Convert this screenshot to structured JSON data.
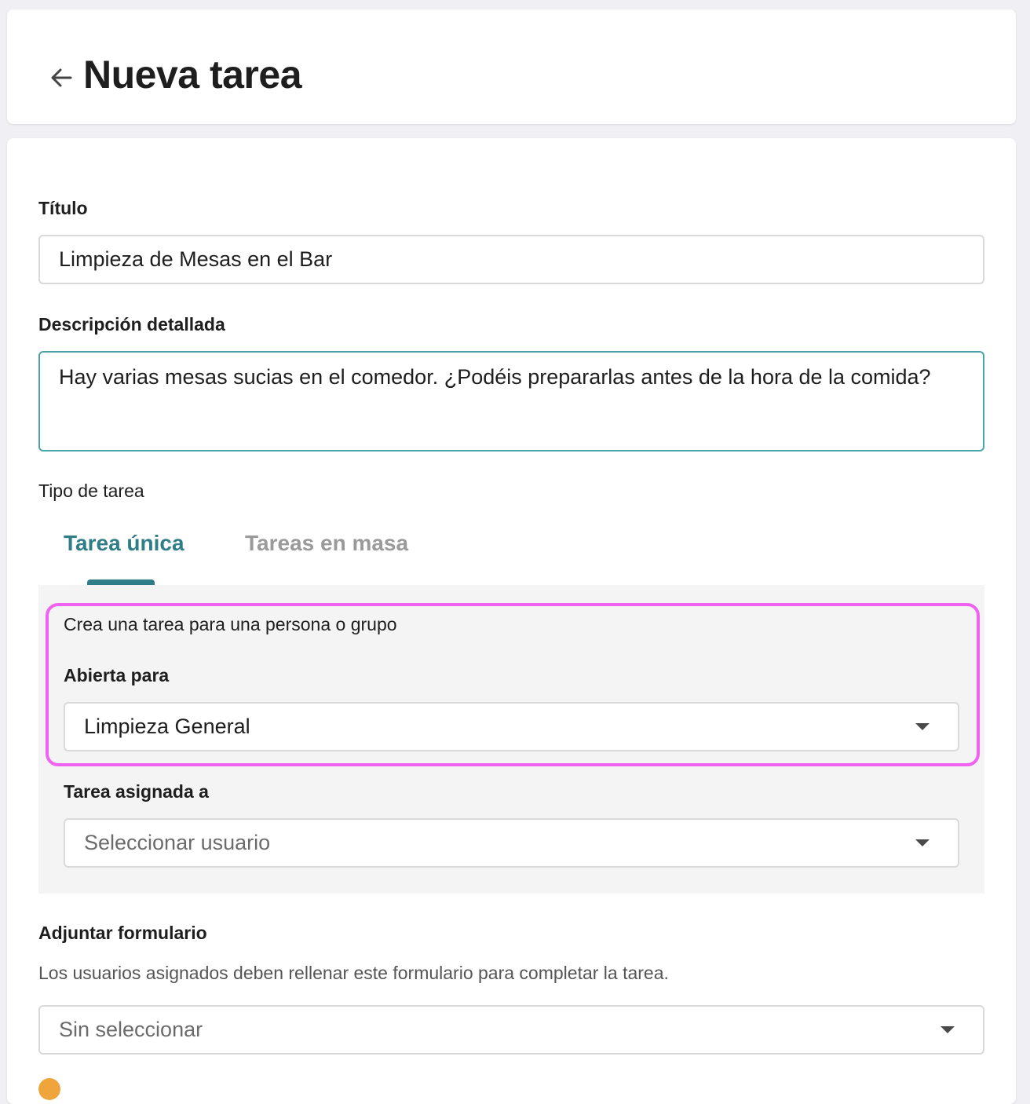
{
  "header": {
    "title": "Nueva tarea"
  },
  "form": {
    "title_label": "Título",
    "title_value": "Limpieza de Mesas en el Bar",
    "description_label": "Descripción detallada",
    "description_value": "Hay varias mesas sucias en el comedor. ¿Podéis prepararlas antes de la hora de la comida?",
    "task_type_label": "Tipo de tarea",
    "tabs": [
      {
        "label": "Tarea única",
        "active": true
      },
      {
        "label": "Tareas en masa",
        "active": false
      }
    ],
    "single_task": {
      "intro": "Crea una tarea para una persona o grupo",
      "open_for_label": "Abierta para",
      "open_for_value": "Limpieza General",
      "assigned_label": "Tarea asignada a",
      "assigned_placeholder": "Seleccionar usuario"
    },
    "attach_form_label": "Adjuntar formulario",
    "attach_form_helper": "Los usuarios asignados deben rellenar este formulario para completar la tarea.",
    "attach_form_value": "Sin seleccionar"
  },
  "colors": {
    "accent": "#2f7d87",
    "highlight": "#f062f0",
    "focus_border": "#4aa3a9"
  }
}
